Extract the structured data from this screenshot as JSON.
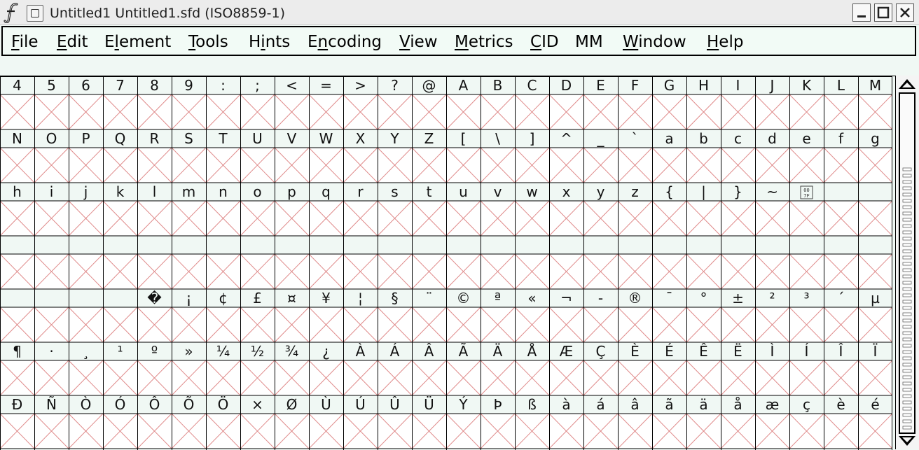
{
  "window": {
    "title": "Untitled1  Untitled1.sfd (ISO8859-1)",
    "minimize_icon": "minimize-icon",
    "maximize_icon": "maximize-icon",
    "close_icon": "close-icon",
    "logo_icon": "fontforge-logo-icon"
  },
  "menu": [
    {
      "pre": "",
      "u": "F",
      "post": "ile",
      "name": "file"
    },
    {
      "pre": "",
      "u": "E",
      "post": "dit",
      "name": "edit"
    },
    {
      "pre": "E",
      "u": "l",
      "post": "ement",
      "name": "element"
    },
    {
      "pre": "",
      "u": "T",
      "post": "ools",
      "name": "tools"
    },
    {
      "pre": "H",
      "u": "i",
      "post": "nts",
      "name": "hints"
    },
    {
      "pre": "E",
      "u": "n",
      "post": "coding",
      "name": "encoding"
    },
    {
      "pre": "",
      "u": "V",
      "post": "iew",
      "name": "view"
    },
    {
      "pre": "",
      "u": "M",
      "post": "etrics",
      "name": "metrics"
    },
    {
      "pre": "",
      "u": "C",
      "post": "ID",
      "name": "cid"
    },
    {
      "pre": "MM",
      "u": "",
      "post": "",
      "name": "mm"
    },
    {
      "pre": "",
      "u": "W",
      "post": "indow",
      "name": "window"
    },
    {
      "pre": "",
      "u": "H",
      "post": "elp",
      "name": "help"
    }
  ],
  "glyph_rows": [
    [
      "4",
      "5",
      "6",
      "7",
      "8",
      "9",
      ":",
      ";",
      "<",
      "=",
      ">",
      "?",
      "@",
      "A",
      "B",
      "C",
      "D",
      "E",
      "F",
      "G",
      "H",
      "I",
      "J",
      "K",
      "L",
      "M"
    ],
    [
      "N",
      "O",
      "P",
      "Q",
      "R",
      "S",
      "T",
      "U",
      "V",
      "W",
      "X",
      "Y",
      "Z",
      "[",
      "\\",
      "]",
      "^",
      "_",
      "`",
      "a",
      "b",
      "c",
      "d",
      "e",
      "f",
      "g"
    ],
    [
      "h",
      "i",
      "j",
      "k",
      "l",
      "m",
      "n",
      "o",
      "p",
      "q",
      "r",
      "s",
      "t",
      "u",
      "v",
      "w",
      "x",
      "y",
      "z",
      "{",
      "|",
      "}",
      "~",
      "007F",
      "",
      ""
    ],
    [
      "",
      "",
      "",
      "",
      "",
      "",
      "",
      "",
      "",
      "",
      "",
      "",
      "",
      "",
      "",
      "",
      "",
      "",
      "",
      "",
      "",
      "",
      "",
      "",
      "",
      ""
    ],
    [
      "",
      "",
      "",
      "",
      "�",
      "¡",
      "¢",
      "£",
      "¤",
      "¥",
      "¦",
      "§",
      "¨",
      "©",
      "ª",
      "«",
      "¬",
      "-",
      "®",
      "¯",
      "°",
      "±",
      "²",
      "³",
      "´",
      "µ"
    ],
    [
      "¶",
      "·",
      "¸",
      "¹",
      "º",
      "»",
      "¼",
      "½",
      "¾",
      "¿",
      "À",
      "Á",
      "Â",
      "Ã",
      "Ä",
      "Å",
      "Æ",
      "Ç",
      "È",
      "É",
      "Ê",
      "Ë",
      "Ì",
      "Í",
      "Î",
      "Ï"
    ],
    [
      "Ð",
      "Ñ",
      "Ò",
      "Ó",
      "Ô",
      "Õ",
      "Ö",
      "×",
      "Ø",
      "Ù",
      "Ú",
      "Û",
      "Ü",
      "Ý",
      "Þ",
      "ß",
      "à",
      "á",
      "â",
      "ã",
      "ä",
      "å",
      "æ",
      "ç",
      "è",
      "é"
    ]
  ],
  "colors": {
    "background": "#f0f8f4",
    "grid_line": "#000000",
    "empty_glyph_cross": "#e08c8c"
  },
  "scrollbar": {
    "up_icon": "scroll-up-arrow-icon",
    "down_icon": "scroll-down-arrow-icon",
    "thumb_icon": "scroll-thumb-grip-icon"
  }
}
